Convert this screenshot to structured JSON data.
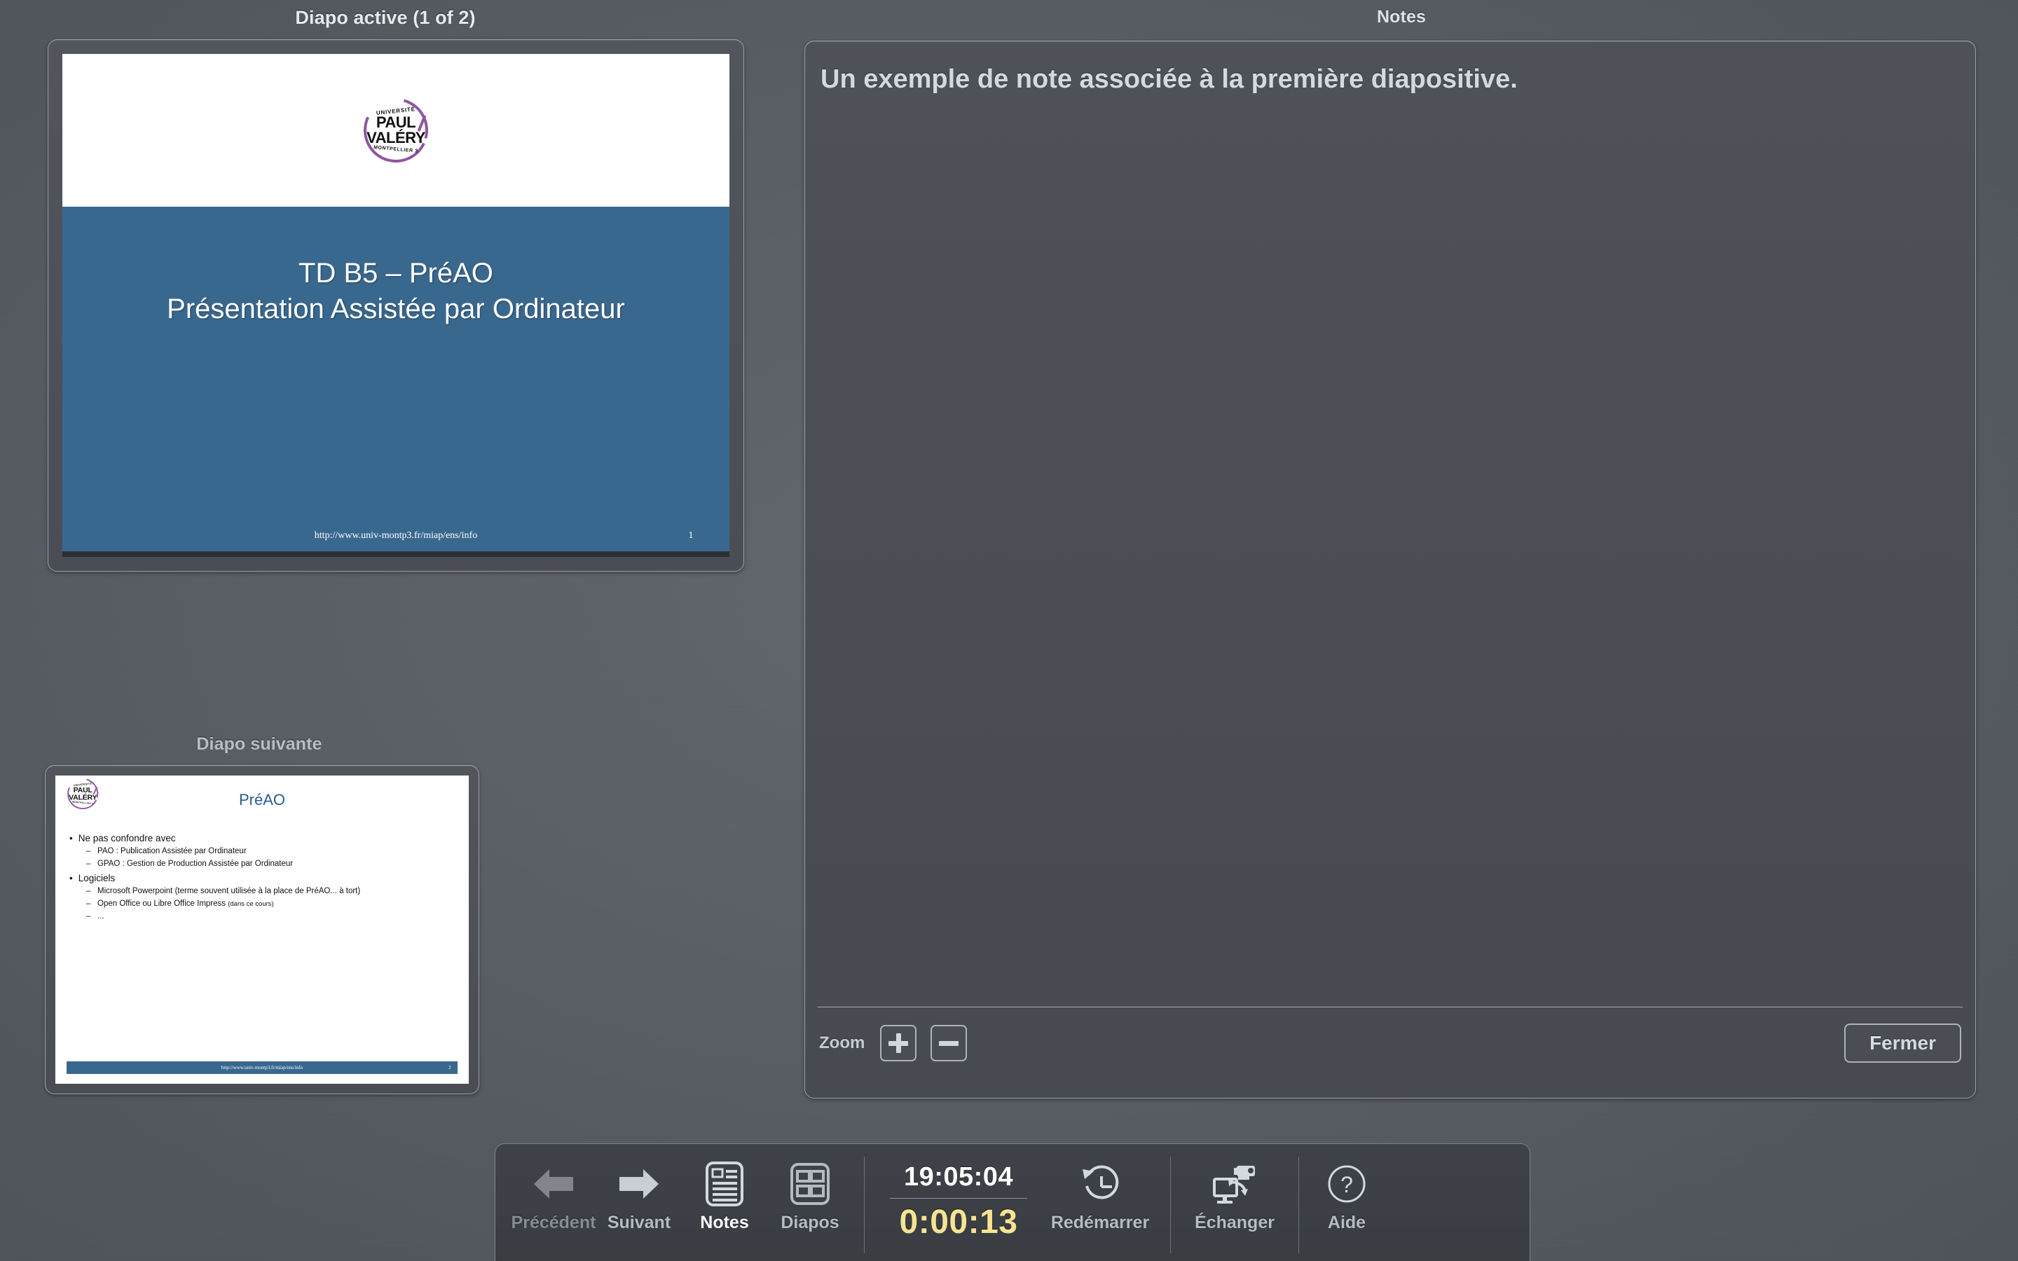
{
  "panels": {
    "current_title": "Diapo active (1 of 2)",
    "notes_title": "Notes",
    "next_title": "Diapo suivante"
  },
  "current_slide": {
    "logo": {
      "line_univ": "UNIVERSITÉ",
      "line_paul": "PAUL",
      "line_valery": "VALÉRY",
      "line_montpellier": "MONTPELLIER 3",
      "accent_color": "#8e56a0"
    },
    "title_line1": "TD B5 – PréAO",
    "title_line2": "Présentation Assistée par Ordinateur",
    "footer_url": "http://www.univ-montp3.fr/miap/ens/info",
    "page_number": "1",
    "background_color": "#39688f"
  },
  "next_slide": {
    "title": "PréAO",
    "bullets": [
      {
        "level": 1,
        "text": "Ne pas confondre avec"
      },
      {
        "level": 2,
        "text": "PAO : Publication Assistée par Ordinateur"
      },
      {
        "level": 2,
        "text": "GPAO : Gestion de Production Assistée par Ordinateur"
      },
      {
        "level": 1,
        "text": "Logiciels"
      },
      {
        "level": 2,
        "text": "Microsoft Powerpoint (terme souvent utilisée à la place de PréAO... à tort)"
      },
      {
        "level": 2,
        "text": "Open Office ou Libre Office Impress ",
        "suffix": "(dans ce cours)"
      },
      {
        "level": 2,
        "text": "..."
      }
    ],
    "footer_url": "http://www.univ-montp3.fr/miap/ens/info",
    "page_number": "2"
  },
  "notes": {
    "text": "Un exemple de note associée à la première diapositive.",
    "zoom_label": "Zoom",
    "zoom_in": "+",
    "zoom_out": "−",
    "close_label": "Fermer"
  },
  "toolbar": {
    "previous_label": "Précédent",
    "next_label": "Suivant",
    "notes_label": "Notes",
    "slides_label": "Diapos",
    "clock": "19:05:04",
    "timer": "0:00:13",
    "restart_label": "Redémarrer",
    "swap_label": "Échanger",
    "help_label": "Aide",
    "timer_color": "#f7e392"
  }
}
